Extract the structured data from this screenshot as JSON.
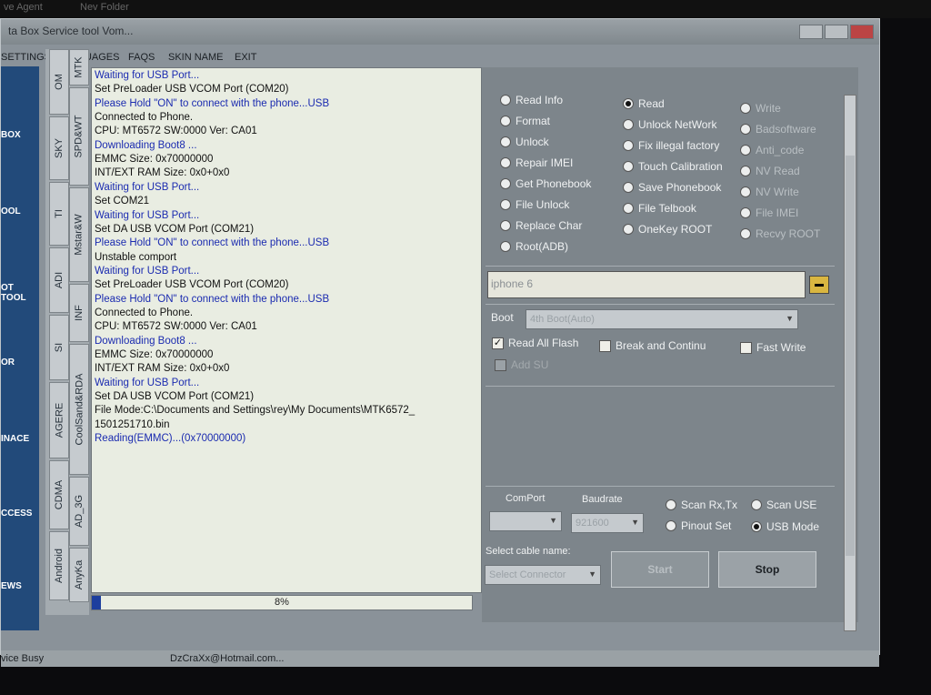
{
  "topbar": {
    "left": "ve Agent",
    "right": "Nev Folder"
  },
  "window": {
    "title": "ta Box Service tool Vom..."
  },
  "menu": [
    "SETTINGS",
    "LANGUAGES",
    "FAQS",
    "SKIN NAME",
    "EXIT"
  ],
  "sidebar": [
    "BOX",
    "OOL",
    "OT TOOL",
    "OR",
    "INACE",
    "CCESS",
    "EWS"
  ],
  "tabs_outer": [
    "OM",
    "SKY",
    "TI",
    "ADI",
    "SI",
    "AGERE",
    "CDMA",
    "Android"
  ],
  "tabs_inner": [
    "MTK",
    "SPD&WT",
    "Mstar&W",
    "INF",
    "CoolSand&RDA",
    "AD_3G",
    "AnyKa"
  ],
  "log": [
    {
      "text": "Waiting for USB Port...",
      "color": "#1b2bb0"
    },
    {
      "text": "Set PreLoader USB VCOM Port (COM20)",
      "color": "#111111"
    },
    {
      "text": "Please Hold \"ON\" to connect with the phone...USB",
      "color": "#1b2bb0"
    },
    {
      "text": "Connected to Phone.",
      "color": "#111111"
    },
    {
      "text": "CPU: MT6572 SW:0000 Ver: CA01",
      "color": "#111111"
    },
    {
      "text": "Downloading Boot8 ...",
      "color": "#1b2bb0"
    },
    {
      "text": "EMMC Size: 0x70000000",
      "color": "#111111"
    },
    {
      "text": "INT/EXT RAM  Size: 0x0+0x0",
      "color": "#111111"
    },
    {
      "text": "Waiting for USB Port...",
      "color": "#1b2bb0"
    },
    {
      "text": "Set COM21",
      "color": "#111111"
    },
    {
      "text": "Waiting for USB Port...",
      "color": "#1b2bb0"
    },
    {
      "text": "Set DA USB VCOM Port (COM21)",
      "color": "#111111"
    },
    {
      "text": "Please Hold \"ON\" to connect with the phone...USB",
      "color": "#1b2bb0"
    },
    {
      "text": "Unstable comport",
      "color": "#111111"
    },
    {
      "text": "Waiting for USB Port...",
      "color": "#1b2bb0"
    },
    {
      "text": "Set PreLoader USB VCOM Port (COM20)",
      "color": "#111111"
    },
    {
      "text": "Please Hold \"ON\" to connect with the phone...USB",
      "color": "#1b2bb0"
    },
    {
      "text": "Connected to Phone.",
      "color": "#111111"
    },
    {
      "text": "CPU: MT6572 SW:0000 Ver: CA01",
      "color": "#111111"
    },
    {
      "text": "Downloading Boot8 ...",
      "color": "#1b2bb0"
    },
    {
      "text": "EMMC Size: 0x70000000",
      "color": "#111111"
    },
    {
      "text": "INT/EXT RAM  Size: 0x0+0x0",
      "color": "#111111"
    },
    {
      "text": "Waiting for USB Port...",
      "color": "#1b2bb0"
    },
    {
      "text": "Set DA USB VCOM Port (COM21)",
      "color": "#111111"
    },
    {
      "text": "File Mode:C:\\Documents and Settings\\rey\\My Documents\\MTK6572_",
      "color": "#111111"
    },
    {
      "text": "1501251710.bin",
      "color": "#111111"
    },
    {
      "text": "Reading(EMMC)...(0x70000000)",
      "color": "#1b2bb0"
    }
  ],
  "progress": {
    "label": "8%",
    "fraction": 0.08
  },
  "ops_col1": [
    {
      "label": "Read Info",
      "selected": false
    },
    {
      "label": "Format",
      "selected": false
    },
    {
      "label": "Unlock",
      "selected": false
    },
    {
      "label": "Repair IMEI",
      "selected": false
    },
    {
      "label": "Get Phonebook",
      "selected": false
    },
    {
      "label": "File Unlock",
      "selected": false
    },
    {
      "label": "Replace Char",
      "selected": false
    },
    {
      "label": "Root(ADB)",
      "selected": false
    }
  ],
  "ops_col2": [
    {
      "label": "Read",
      "selected": true
    },
    {
      "label": "Unlock NetWork",
      "selected": false
    },
    {
      "label": "Fix illegal factory",
      "selected": false
    },
    {
      "label": "Touch Calibration",
      "selected": false
    },
    {
      "label": "Save Phonebook",
      "selected": false
    },
    {
      "label": "File Telbook",
      "selected": false
    },
    {
      "label": "OneKey ROOT",
      "selected": false
    }
  ],
  "ops_col3": [
    {
      "label": "Write",
      "selected": false
    },
    {
      "label": "Badsoftware",
      "selected": false
    },
    {
      "label": "Anti_code",
      "selected": false
    },
    {
      "label": "NV Read",
      "selected": false
    },
    {
      "label": "NV Write",
      "selected": false
    },
    {
      "label": "File IMEI",
      "selected": false
    },
    {
      "label": "Recvy ROOT",
      "selected": false
    }
  ],
  "model": {
    "value": "iphone 6"
  },
  "boot": {
    "label": "Boot",
    "value": "4th Boot(Auto)"
  },
  "checks": [
    {
      "label": "Read All Flash",
      "checked": true,
      "enabled": true
    },
    {
      "label": "Break and Continu",
      "checked": false,
      "enabled": true
    },
    {
      "label": "Fast Write",
      "checked": false,
      "enabled": true
    },
    {
      "label": "Add SU",
      "checked": false,
      "enabled": false
    }
  ],
  "comport": {
    "label": "ComPort",
    "value": ""
  },
  "baudrate": {
    "label": "Baudrate",
    "value": "921600"
  },
  "scan_options": [
    {
      "label": "Scan Rx,Tx",
      "selected": false
    },
    {
      "label": "Scan USE",
      "selected": false
    },
    {
      "label": "Pinout Set",
      "selected": false
    },
    {
      "label": "USB Mode",
      "selected": true
    }
  ],
  "cable": {
    "label": "Select cable name:",
    "placeholder": "Select Connector"
  },
  "buttons": {
    "start": "Start",
    "stop": "Stop"
  },
  "status": {
    "left": "vice Busy",
    "email": "DzCraXx@Hotmail.com..."
  },
  "colors": {
    "log_blue": "#1b2bb0",
    "progress_fill": "#1d3f9e",
    "panel": "#7d858b",
    "sidebar": "#224a7a"
  }
}
